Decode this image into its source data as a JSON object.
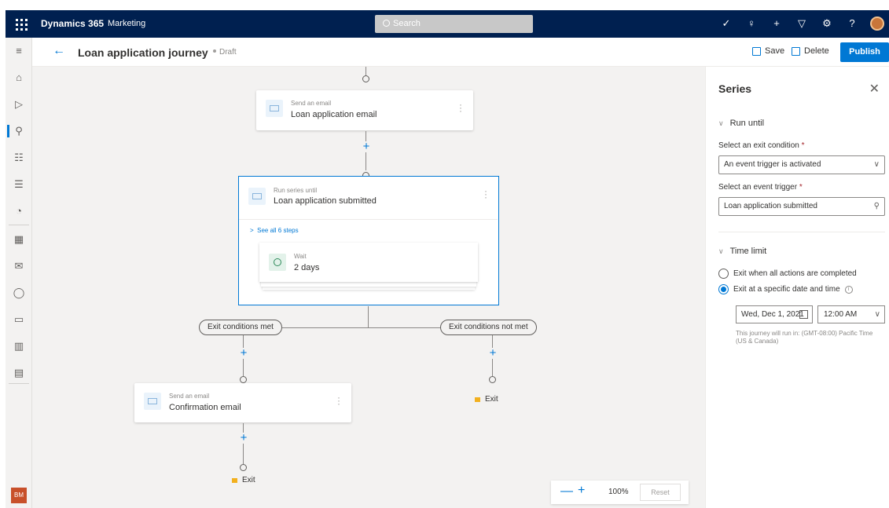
{
  "topbar": {
    "app_name": "Dynamics 365",
    "module": "Marketing",
    "search_placeholder": "Search",
    "icons": [
      "task-icon",
      "lightbulb-icon",
      "plus-icon",
      "filter-icon",
      "settings-icon",
      "help-icon",
      "avatar"
    ]
  },
  "leftnav": {
    "items": [
      "hamburger-icon",
      "home-icon",
      "play-icon",
      "journeys-icon",
      "segments-icon",
      "forms-icon",
      "analytics-icon",
      "calendar-icon",
      "email-icon",
      "push-icon",
      "sms-icon",
      "library-icon",
      "assets-icon"
    ],
    "user_initials": "BM"
  },
  "command_bar": {
    "title": "Loan application journey",
    "status": "Draft",
    "save_label": "Save",
    "delete_label": "Delete",
    "publish_label": "Publish"
  },
  "canvas": {
    "email1": {
      "subtitle": "Send an email",
      "title": "Loan application email"
    },
    "series": {
      "subtitle": "Run series until",
      "title": "Loan application submitted",
      "see_all": "See all 6 steps"
    },
    "wait": {
      "subtitle": "Wait",
      "title": "2 days"
    },
    "branch_met": "Exit conditions met",
    "branch_not_met": "Exit conditions not met",
    "email2": {
      "subtitle": "Send an email",
      "title": "Confirmation email"
    },
    "exit_label": "Exit",
    "exit_label_2": "Exit",
    "zoom_level": "100%",
    "reset_label": "Reset"
  },
  "panel": {
    "title": "Series",
    "run_until_header": "Run until",
    "exit_condition_label": "Select an exit condition",
    "exit_condition_value": "An event trigger is activated",
    "event_trigger_label": "Select an event trigger",
    "event_trigger_value": "Loan application submitted",
    "required_mark": "*",
    "time_limit_header": "Time limit",
    "radio_all_actions": "Exit when all actions are completed",
    "radio_specific": "Exit at a specific date and time",
    "date_value": "Wed, Dec 1, 2021",
    "time_value": "12:00 AM",
    "timezone_note": "This journey will run in: (GMT-08:00) Pacific Time (US & Canada)",
    "selected_radio": "specific"
  },
  "colors": {
    "topbar": "#002050",
    "accent": "#0078d4",
    "canvas": "#f3f2f1",
    "flag": "#f2b01e"
  }
}
